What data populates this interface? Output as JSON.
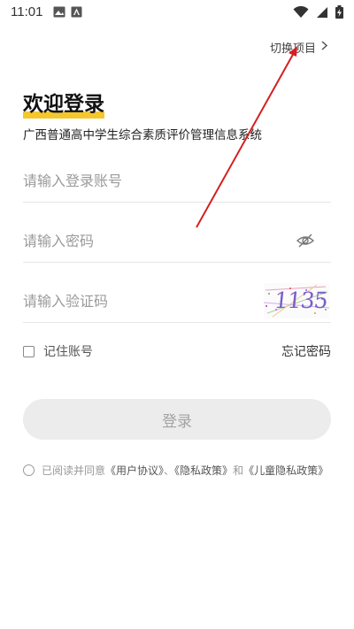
{
  "status_bar": {
    "time": "11:01"
  },
  "header": {
    "switch_project_label": "切换项目"
  },
  "login": {
    "title": "欢迎登录",
    "subtitle": "广西普通高中学生综合素质评价管理信息系统",
    "account_placeholder": "请输入登录账号",
    "password_placeholder": "请输入密码",
    "captcha_placeholder": "请输入验证码",
    "captcha_text": "1135",
    "remember_label": "记住账号",
    "forgot_label": "忘记密码",
    "login_button_label": "登录"
  },
  "agreement": {
    "prefix": "已阅读并同意",
    "user_agreement": "《用户协议》",
    "sep1": "、",
    "privacy_policy": "《隐私政策》",
    "sep2": "和",
    "child_privacy_policy": "《儿童隐私政策》"
  },
  "colors": {
    "accent_underline": "#f5c72e",
    "annotation_arrow": "#d32020",
    "button_disabled_bg": "#ececec"
  }
}
